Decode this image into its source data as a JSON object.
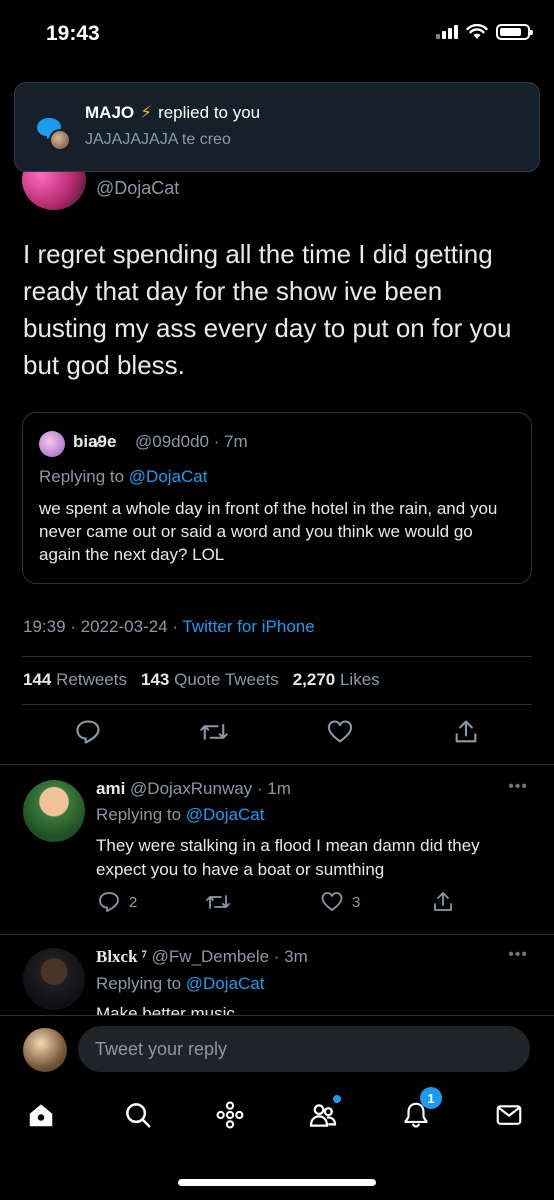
{
  "status_bar": {
    "time": "19:43"
  },
  "notification": {
    "name": "MAJO",
    "bolt": "⚡",
    "action": "replied to you",
    "message": "JAJAJAJAJA te creo"
  },
  "tweet": {
    "handle": "@DojaCat",
    "text": "I regret spending all the time I did getting ready that day for the show ive been busting my ass every day to put on for you but god bless.",
    "quoted": {
      "name": "bia̷9e",
      "handle_time": "@09d0d0 · 7m",
      "replying_prefix": "Replying to",
      "replying_mention": "@DojaCat",
      "text": "we spent a whole day in front of the hotel in the rain, and you never came out or said a word and you think we would go again the next day? LOL"
    },
    "meta_time": "19:39 · 2022-03-24 · ",
    "meta_source": "Twitter for iPhone",
    "stats": {
      "retweets_count": "144",
      "retweets_label": "Retweets",
      "quotes_count": "143",
      "quotes_label": "Quote Tweets",
      "likes_count": "2,270",
      "likes_label": "Likes"
    }
  },
  "replies": [
    {
      "name": "ami",
      "handle_time": "@DojaxRunway · 1m",
      "replying_prefix": "Replying to",
      "replying_mention": "@DojaCat",
      "text": "They were stalking in a flood I mean damn did they expect you to have a boat or sumthing",
      "reply_count": "2",
      "like_count": "3"
    },
    {
      "name": "Blxck ⁷",
      "handle_time": "@Fw_Dembele · 3m",
      "replying_prefix": "Replying to",
      "replying_mention": "@DojaCat",
      "text": "Make better music"
    }
  ],
  "composer": {
    "placeholder": "Tweet your reply"
  },
  "tabbar": {
    "notifications_badge": "1"
  },
  "colors": {
    "accent": "#1d9bf0",
    "background": "#000000",
    "muted": "#8b98a5"
  }
}
